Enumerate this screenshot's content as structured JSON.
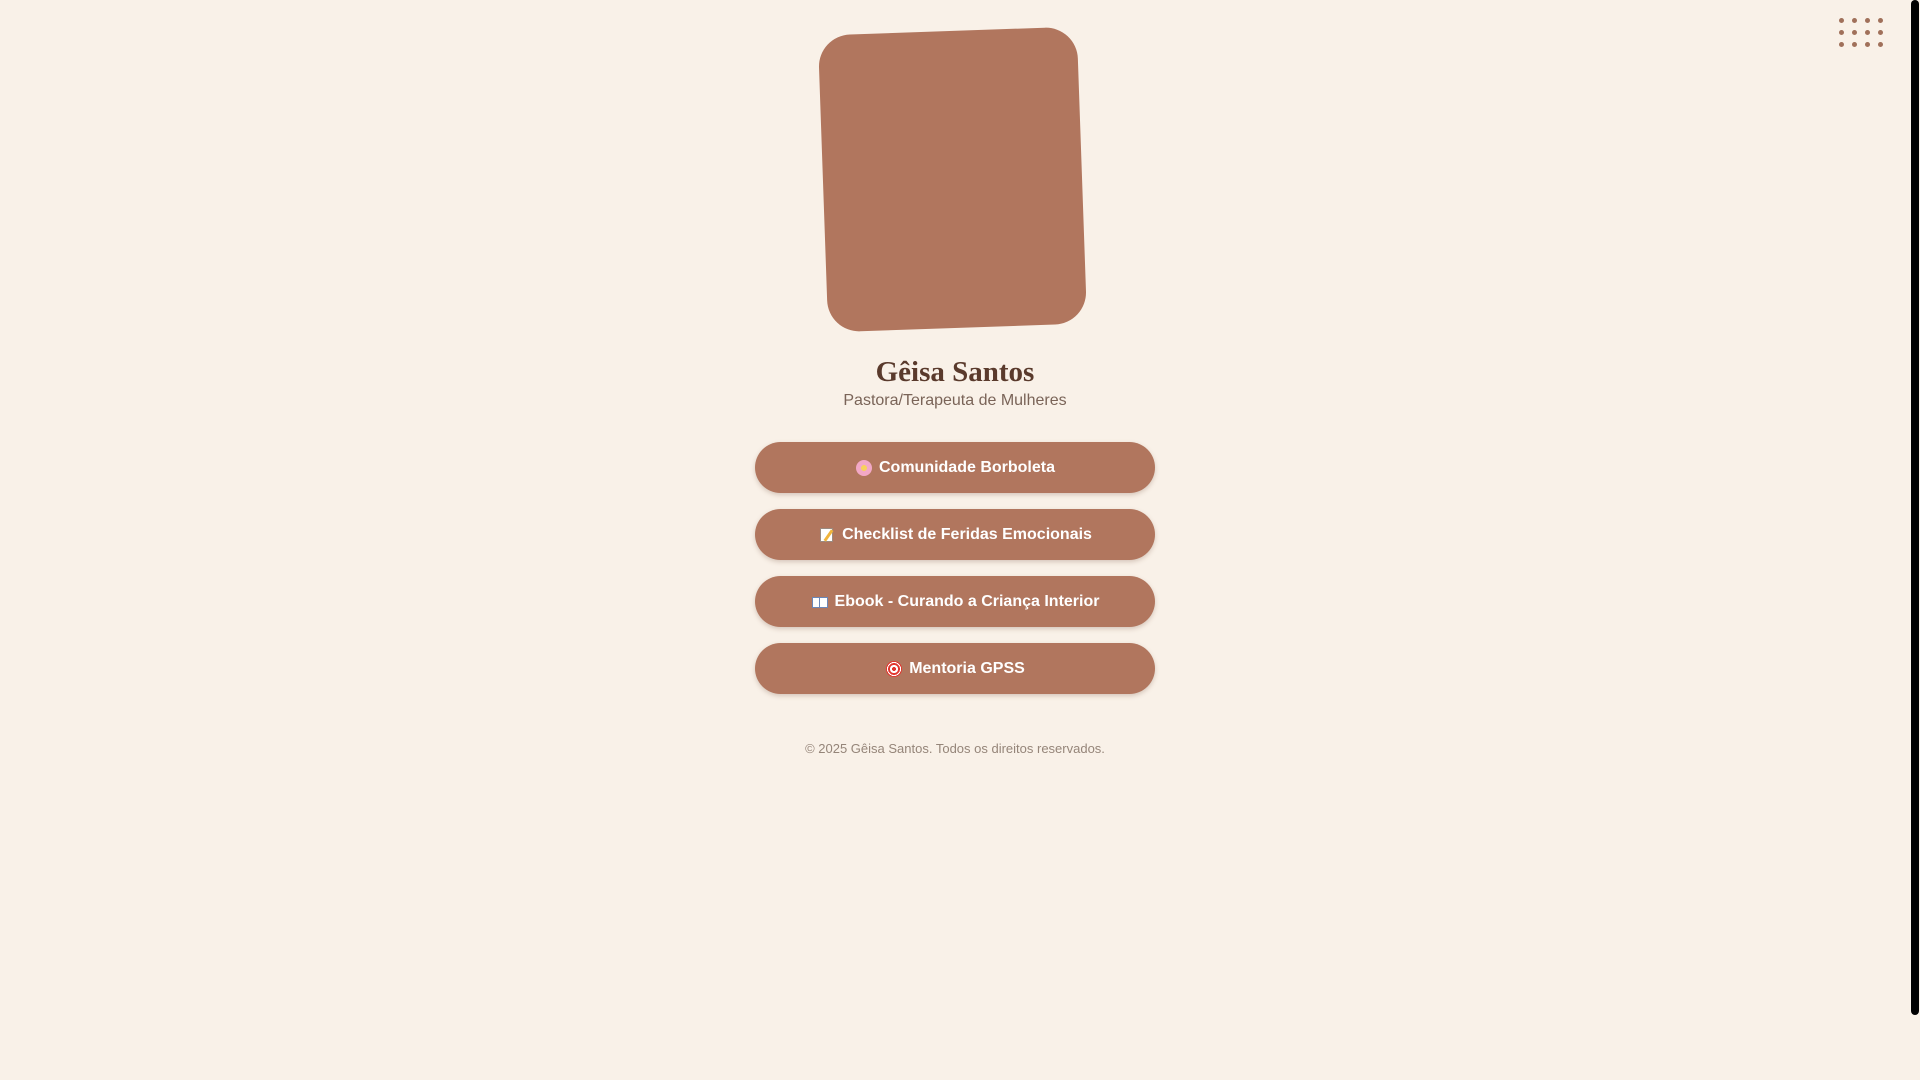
{
  "profile": {
    "name": "Gêisa Santos",
    "subtitle": "Pastora/Terapeuta de Mulheres"
  },
  "links": [
    {
      "icon": "cherry-blossom-icon",
      "label": "Comunidade Borboleta"
    },
    {
      "icon": "memo-icon",
      "label": "Checklist de Feridas Emocionais"
    },
    {
      "icon": "open-book-icon",
      "label": "Ebook - Curando a Criança Interior"
    },
    {
      "icon": "target-icon",
      "label": "Mentoria GPSS"
    }
  ],
  "footer": {
    "text": "© 2025 Gêisa Santos. Todos os direitos reservados."
  },
  "colors": {
    "background": "#f9f1e8",
    "accent": "#b1765e",
    "name_text": "#5a3a2c"
  }
}
